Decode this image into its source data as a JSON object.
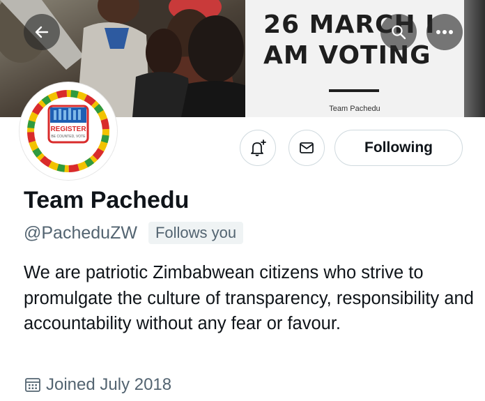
{
  "banner": {
    "headline_line1": "26 MARCH I",
    "headline_line2": "AM VOTING",
    "signature": "Team Pachedu"
  },
  "avatar": {
    "logo_line1": "REGISTER",
    "logo_line2": "BE COUNTED, VOTE"
  },
  "actions": {
    "following_label": "Following"
  },
  "profile": {
    "display_name": "Team Pachedu",
    "handle": "@PacheduZW",
    "follows_you_badge": "Follows you",
    "bio": "We are patriotic Zimbabwean citizens who strive to promulgate the culture of transparency, responsibility and accountability without any fear or favour.",
    "joined": "Joined July 2018"
  },
  "icons": {
    "back": "arrow-left-icon",
    "search": "search-icon",
    "more": "more-icon",
    "notify": "bell-plus-icon",
    "message": "envelope-icon",
    "calendar": "calendar-icon"
  },
  "colors": {
    "text_primary": "#0f1419",
    "text_secondary": "#536471",
    "button_border": "#cfd9de",
    "badge_bg": "#eff3f4"
  }
}
